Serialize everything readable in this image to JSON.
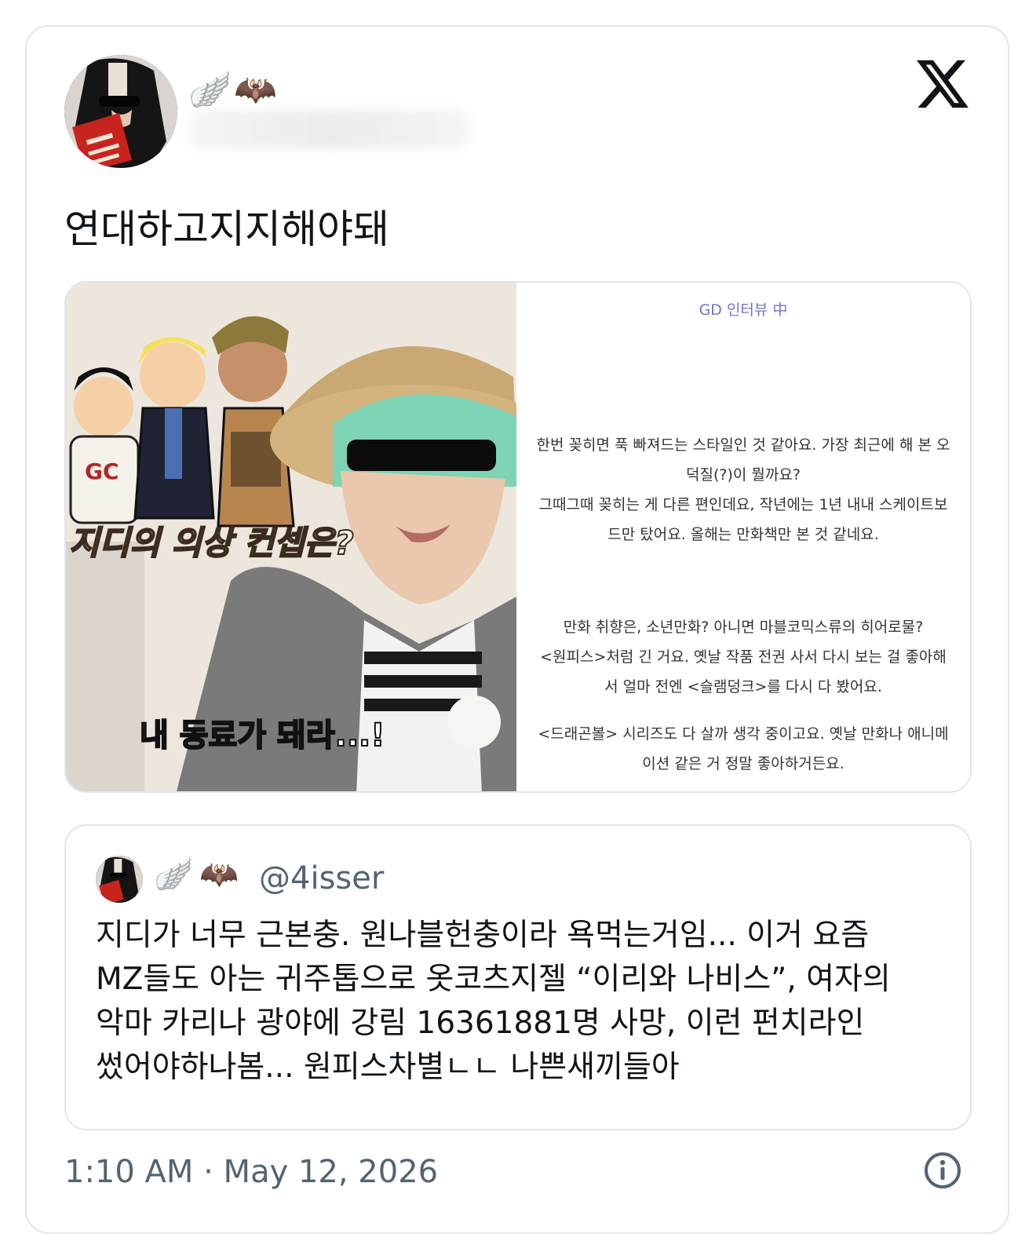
{
  "author": {
    "emojis": [
      "🪽",
      "🦇"
    ]
  },
  "brand": {
    "logo": "x-logo"
  },
  "tweet": {
    "text": "연대하고지지해야돼"
  },
  "media": {
    "left_image": {
      "caption_top": "지디의 의상 컨셉은?",
      "caption_bottom": "내 동료가 돼라...!",
      "shirt_text": "GC"
    },
    "right_image": {
      "title": "GD 인터뷰 中",
      "paragraphs": [
        "한번 꽂히면 푹 빠져드는 스타일인 것 같아요. 가장 최근에 해 본 오덕질(?)이 뭘까요?",
        "그때그때 꽂히는 게 다른 편인데요, 작년에는 1년 내내 스케이트보드만 탔어요. 올해는 만화책만 본 것 같네요.",
        "만화 취향은, 소년만화? 아니면 마블코믹스류의 히어로물?",
        "<원피스>처럼 긴 거요. 옛날 작품 전권 사서 다시 보는 걸 좋아해서 얼마 전엔 <슬램덩크>를 다시 다 봤어요.",
        "<드래곤볼> 시리즈도 다 살까 생각 중이고요. 옛날 만화나 애니메이션 같은 거 정말 좋아하거든요."
      ]
    }
  },
  "quoted": {
    "emojis": [
      "🪽",
      "🦇"
    ],
    "handle": "@4isser",
    "lines": [
      "지디가 너무 근본충. 원나블헌충이라 욕먹는거임... 이거 요즘",
      "MZ들도 아는 귀주톱으로 옷코츠지젤 “이리와 나비스”, 여자의",
      "악마 카리나 광야에 강림 16361881명 사망, 이런 펀치라인",
      "썼어야하나봄... 원피스차별ㄴㄴ 나쁜새끼들아"
    ]
  },
  "meta": {
    "timestamp": "1:10 AM · May 12, 2026",
    "info_icon": "info-icon"
  }
}
